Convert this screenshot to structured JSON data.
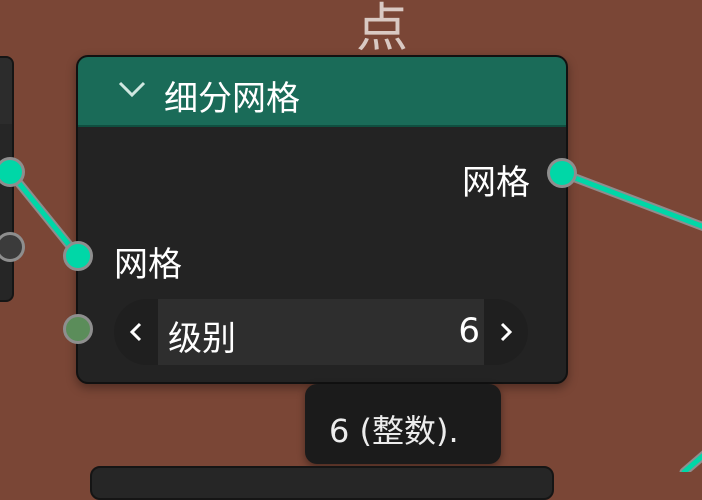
{
  "frame": {
    "label": "点"
  },
  "node": {
    "title": "细分网格",
    "header_color": "#1a6b58",
    "output_socket": {
      "label": "网格",
      "type": "geometry"
    },
    "input_socket": {
      "label": "网格",
      "type": "geometry"
    },
    "level_field": {
      "label": "级别",
      "value": "6",
      "type": "integer"
    }
  },
  "tooltip": {
    "text": "6 (整数)."
  },
  "colors": {
    "background": "#7a4636",
    "geometry_socket": "#00d7a7",
    "integer_socket": "#5b8d5a",
    "node_body": "#232323"
  },
  "icons": {
    "collapse": "chevron-down-icon",
    "decrement": "chevron-left-icon",
    "increment": "chevron-right-icon"
  }
}
